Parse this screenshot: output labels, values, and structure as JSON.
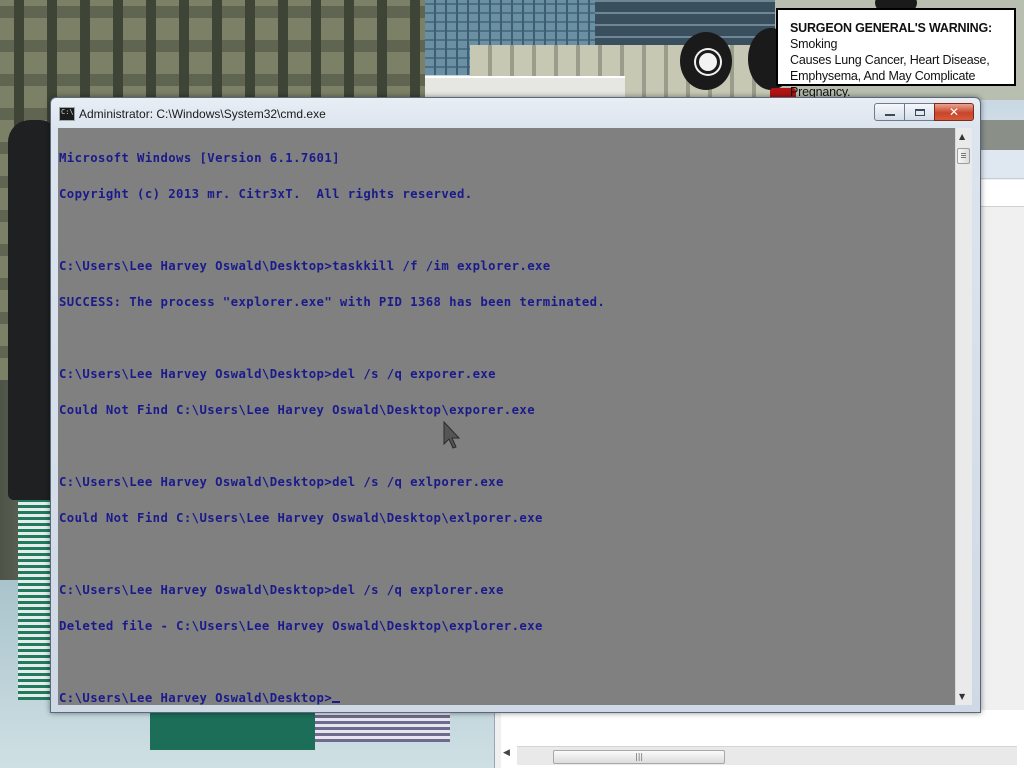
{
  "warning": {
    "heading": "SURGEON GENERAL'S WARNING:",
    "line1_tail": " Smoking",
    "line2": "Causes Lung Cancer, Heart Disease,",
    "line3": "Emphysema, And May Complicate Pregnancy."
  },
  "cmd_window": {
    "title": "Administrator: C:\\Windows\\System32\\cmd.exe",
    "icon": "cmd-app-icon",
    "buttons": {
      "minimize": "minimize-icon",
      "maximize": "maximize-icon",
      "close": "close-icon"
    },
    "colors": {
      "console_bg": "#808080",
      "console_text": "#1a1a8c"
    },
    "lines": [
      "Microsoft Windows [Version 6.1.7601]",
      "Copyright (c) 2013 mr. Citr3xT.  All rights reserved.",
      "",
      "C:\\Users\\Lee Harvey Oswald\\Desktop>taskkill /f /im explorer.exe",
      "SUCCESS: The process \"explorer.exe\" with PID 1368 has been terminated.",
      "",
      "C:\\Users\\Lee Harvey Oswald\\Desktop>del /s /q exporer.exe",
      "Could Not Find C:\\Users\\Lee Harvey Oswald\\Desktop\\exporer.exe",
      "",
      "C:\\Users\\Lee Harvey Oswald\\Desktop>del /s /q exlporer.exe",
      "Could Not Find C:\\Users\\Lee Harvey Oswald\\Desktop\\exlporer.exe",
      "",
      "C:\\Users\\Lee Harvey Oswald\\Desktop>del /s /q explorer.exe",
      "Deleted file - C:\\Users\\Lee Harvey Oswald\\Desktop\\explorer.exe",
      "",
      "C:\\Users\\Lee Harvey Oswald\\Desktop>"
    ]
  }
}
